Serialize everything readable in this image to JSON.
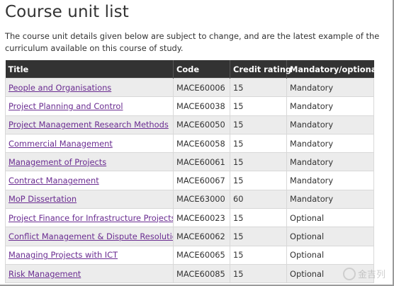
{
  "page": {
    "title": "Course unit list",
    "intro": "The course unit details given below are subject to change, and are the latest example of the curriculum available on this course of study."
  },
  "table": {
    "headers": [
      "Title",
      "Code",
      "Credit rating",
      "Mandatory/optional"
    ],
    "rows": [
      {
        "title": "People and Organisations",
        "code": "MACE60006",
        "credit": "15",
        "status": "Mandatory"
      },
      {
        "title": "Project Planning and Control",
        "code": "MACE60038",
        "credit": "15",
        "status": "Mandatory"
      },
      {
        "title": "Project Management Research Methods",
        "code": "MACE60050",
        "credit": "15",
        "status": "Mandatory"
      },
      {
        "title": "Commercial Management",
        "code": "MACE60058",
        "credit": "15",
        "status": "Mandatory"
      },
      {
        "title": "Management of Projects",
        "code": "MACE60061",
        "credit": "15",
        "status": "Mandatory"
      },
      {
        "title": "Contract Management",
        "code": "MACE60067",
        "credit": "15",
        "status": "Mandatory"
      },
      {
        "title": "MoP Dissertation",
        "code": "MACE63000",
        "credit": "60",
        "status": "Mandatory"
      },
      {
        "title": "Project Finance for Infrastructure Projects",
        "code": "MACE60023",
        "credit": "15",
        "status": "Optional"
      },
      {
        "title": "Conflict Management & Dispute Resolution",
        "code": "MACE60062",
        "credit": "15",
        "status": "Optional"
      },
      {
        "title": "Managing Projects with ICT",
        "code": "MACE60065",
        "credit": "15",
        "status": "Optional"
      },
      {
        "title": "Risk Management",
        "code": "MACE60085",
        "credit": "15",
        "status": "Optional"
      }
    ]
  },
  "watermark": {
    "text": "金吉列"
  },
  "colors": {
    "header_bg": "#333333",
    "link": "#6a2c91",
    "row_alt": "#ececec"
  }
}
